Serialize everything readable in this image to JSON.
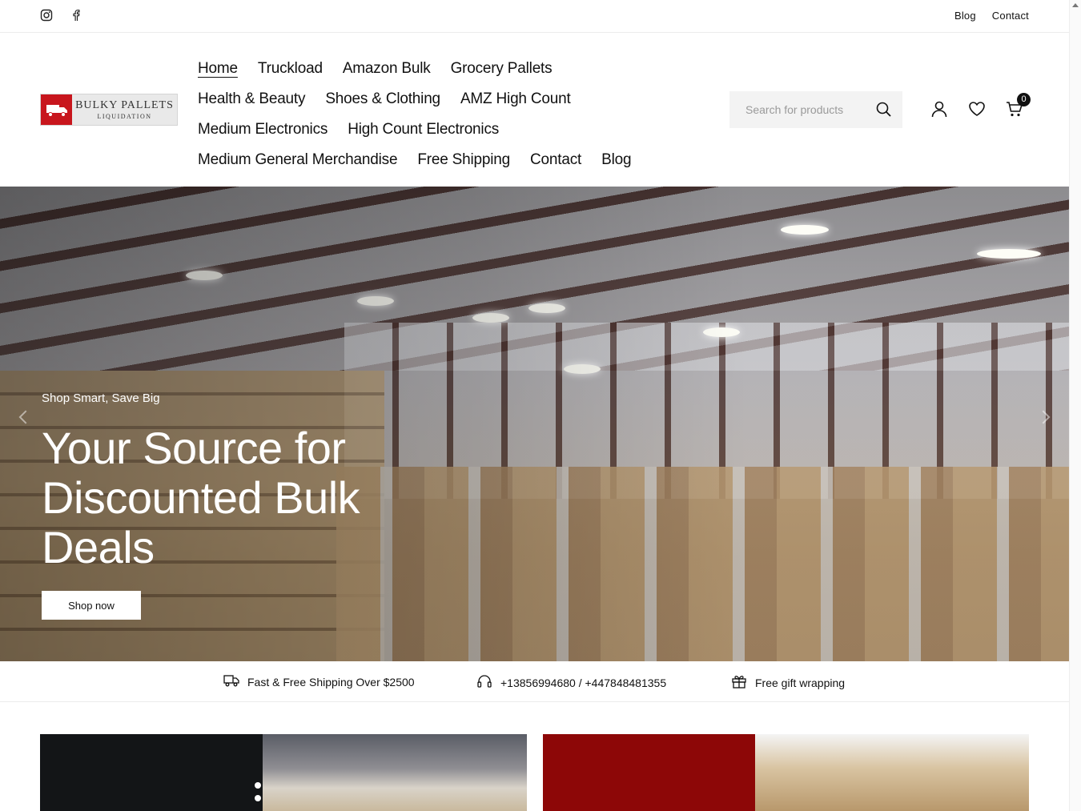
{
  "topbar": {
    "social": [
      {
        "icon": "instagram-icon"
      },
      {
        "icon": "facebook-icon"
      }
    ],
    "links": [
      "Blog",
      "Contact"
    ]
  },
  "logo": {
    "title": "BULKY PALLETS",
    "subtitle": "LIQUIDATION",
    "brand_color": "#c8161d"
  },
  "nav": {
    "rows": [
      [
        "Home",
        "Truckload",
        "Amazon Bulk",
        "Grocery Pallets"
      ],
      [
        "Health & Beauty",
        "Shoes & Clothing",
        "AMZ High Count"
      ],
      [
        "Medium Electronics",
        "High Count Electronics"
      ],
      [
        "Medium General Merchandise",
        "Free Shipping",
        "Contact",
        "Blog"
      ]
    ],
    "active": "Home"
  },
  "search": {
    "placeholder": "Search for products"
  },
  "header_icons": {
    "account": "user-icon",
    "wishlist": "heart-icon",
    "cart": "cart-icon",
    "cart_count": "0"
  },
  "hero": {
    "eyebrow": "Shop Smart, Save Big",
    "title": "Your Source for Discounted Bulk Deals",
    "button": "Shop now"
  },
  "features": [
    {
      "icon": "truck-icon",
      "text": "Fast & Free Shipping Over $2500"
    },
    {
      "icon": "headset-icon",
      "text": "+13856994680 / +447848481355"
    },
    {
      "icon": "gift-icon",
      "text": "Free gift wrapping"
    }
  ],
  "colors": {
    "accent": "#111111",
    "banner_dark": "#131517",
    "banner_red": "#8d0707"
  }
}
